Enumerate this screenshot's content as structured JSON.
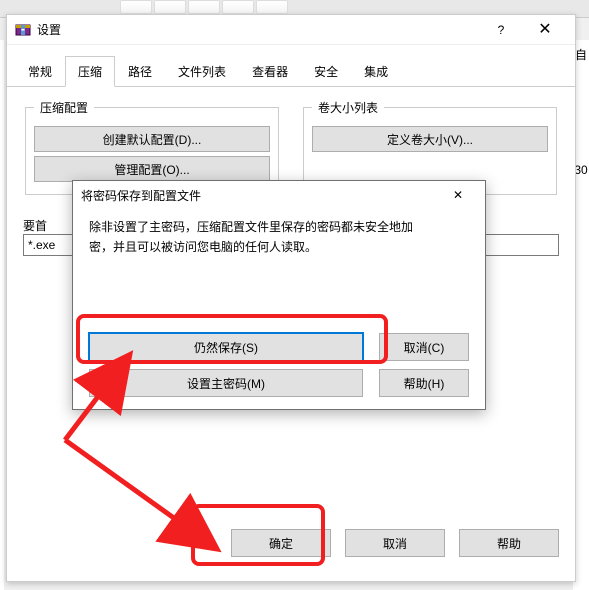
{
  "bg": {
    "right_text_1": "自",
    "right_text_2": "30"
  },
  "settings": {
    "title": "设置",
    "tabs": [
      "常规",
      "压缩",
      "路径",
      "文件列表",
      "查看器",
      "安全",
      "集成"
    ],
    "active_tab_index": 1,
    "group_compress": {
      "legend": "压缩配置",
      "btn_create": "创建默认配置(D)...",
      "btn_manage": "管理配置(O)..."
    },
    "group_volume": {
      "legend": "卷大小列表",
      "btn_define": "定义卷大小(V)..."
    },
    "default_label": "要首",
    "default_value": "*.exe",
    "footer": {
      "ok": "确定",
      "cancel": "取消",
      "help": "帮助"
    }
  },
  "inner": {
    "title": "将密码保存到配置文件",
    "message_line1": "除非设置了主密码，压缩配置文件里保存的密码都未安全地加",
    "message_line2": "密，并且可以被访问您电脑的任何人读取。",
    "btn_save": "仍然保存(S)",
    "btn_master": "设置主密码(M)",
    "btn_cancel": "取消(C)",
    "btn_help": "帮助(H)"
  }
}
